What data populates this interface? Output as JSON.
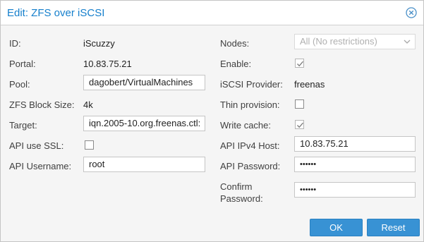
{
  "dialog": {
    "title": "Edit: ZFS over iSCSI",
    "close_icon": "close-circle-icon",
    "accent_color": "#157fcc",
    "button_color": "#3892d4"
  },
  "left": {
    "id_label": "ID:",
    "id_value": "iScuzzy",
    "portal_label": "Portal:",
    "portal_value": "10.83.75.21",
    "pool_label": "Pool:",
    "pool_value": "dagobert/VirtualMachines",
    "block_size_label": "ZFS Block Size:",
    "block_size_value": "4k",
    "target_label": "Target:",
    "target_value": "iqn.2005-10.org.freenas.ctl:",
    "api_ssl_label": "API use SSL:",
    "api_ssl_checked": false,
    "api_username_label": "API Username:",
    "api_username_value": "root"
  },
  "right": {
    "nodes_label": "Nodes:",
    "nodes_placeholder": "All (No restrictions)",
    "enable_label": "Enable:",
    "enable_checked": true,
    "iscsi_provider_label": "iSCSI Provider:",
    "iscsi_provider_value": "freenas",
    "thin_provision_label": "Thin provision:",
    "thin_provision_checked": false,
    "write_cache_label": "Write cache:",
    "write_cache_checked": true,
    "api_host_label": "API IPv4 Host:",
    "api_host_value": "10.83.75.21",
    "api_password_label": "API Password:",
    "api_password_value": "••••••",
    "confirm_password_label_1": "Confirm",
    "confirm_password_label_2": "Password:",
    "confirm_password_value": "••••••"
  },
  "footer": {
    "ok_label": "OK",
    "reset_label": "Reset"
  }
}
